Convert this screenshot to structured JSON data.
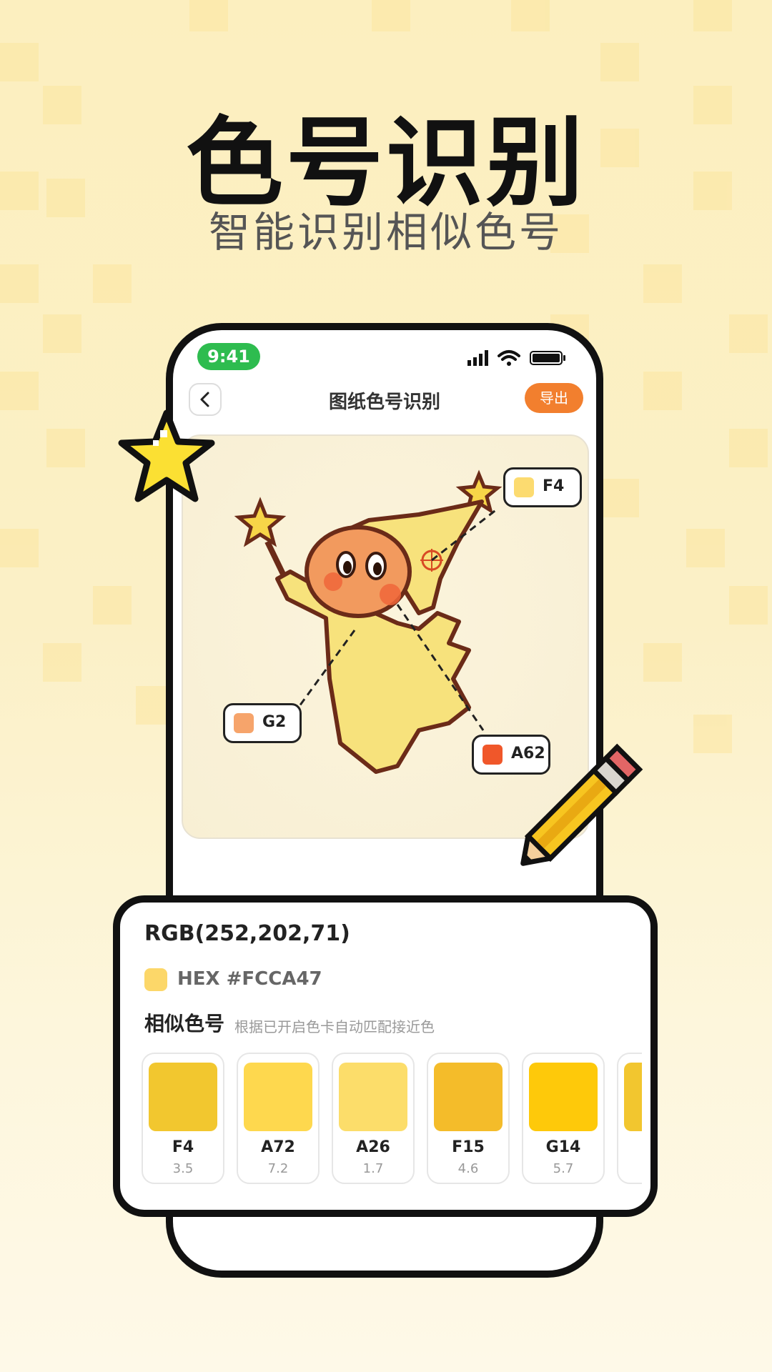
{
  "headline": "色号识别",
  "subline": "智能识别相似色号",
  "status": {
    "time": "9:41"
  },
  "nav": {
    "title": "图纸色号识别",
    "export_label": "导出"
  },
  "callouts": [
    {
      "code": "F4",
      "color": "#fcdb70"
    },
    {
      "code": "G2",
      "color": "#f6a46b"
    },
    {
      "code": "A62",
      "color": "#f0572a"
    }
  ],
  "panel": {
    "rgb": "RGB(252,202,71)",
    "hex": "HEX #FCCA47",
    "hex_color": "#fcd769",
    "similar_title": "相似色号",
    "similar_desc": "根据已开启色卡自动匹配接近色",
    "swatches": [
      {
        "code": "F4",
        "distance": "3.5",
        "color": "#f2c72f"
      },
      {
        "code": "A72",
        "distance": "7.2",
        "color": "#fed84e"
      },
      {
        "code": "A26",
        "distance": "1.7",
        "color": "#fcdd6a"
      },
      {
        "code": "F15",
        "distance": "4.6",
        "color": "#f4bc2a"
      },
      {
        "code": "G14",
        "distance": "5.7",
        "color": "#fec90a"
      },
      {
        "code": "",
        "distance": "",
        "color": "#f2c62f"
      }
    ]
  }
}
